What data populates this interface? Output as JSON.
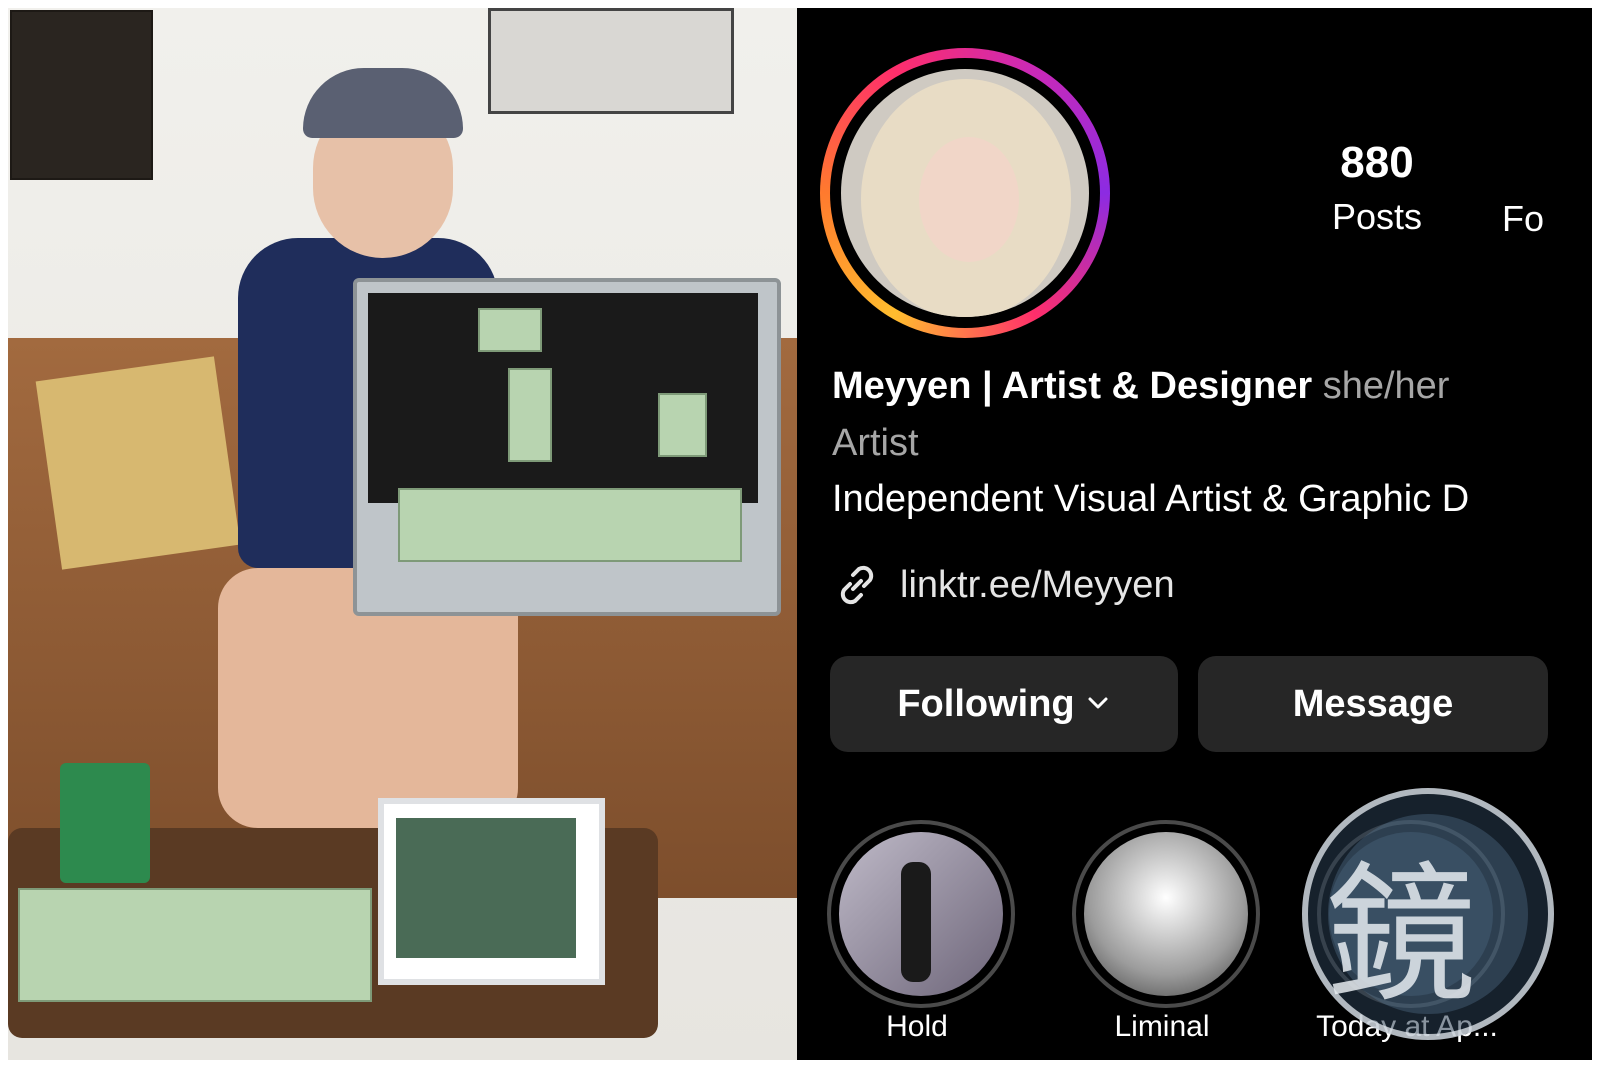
{
  "profile": {
    "stats": [
      {
        "value": "880",
        "label": "Posts"
      },
      {
        "value": "",
        "label": "Fo"
      }
    ],
    "name": "Meyyen | Artist & Designer",
    "pronouns": "she/her",
    "category": "Artist",
    "bio": "Independent Visual Artist & Graphic D",
    "link": "linktr.ee/Meyyen"
  },
  "buttons": {
    "following": "Following",
    "message": "Message"
  },
  "highlights": [
    {
      "label": "Hold"
    },
    {
      "label": "Liminal"
    },
    {
      "label": "Today at Ap..."
    }
  ],
  "colors": {
    "background": "#000000",
    "button_bg": "#262626",
    "secondary_text": "#a6a6a6",
    "ring_start": "#ffbd2e",
    "ring_end": "#c929b8"
  }
}
